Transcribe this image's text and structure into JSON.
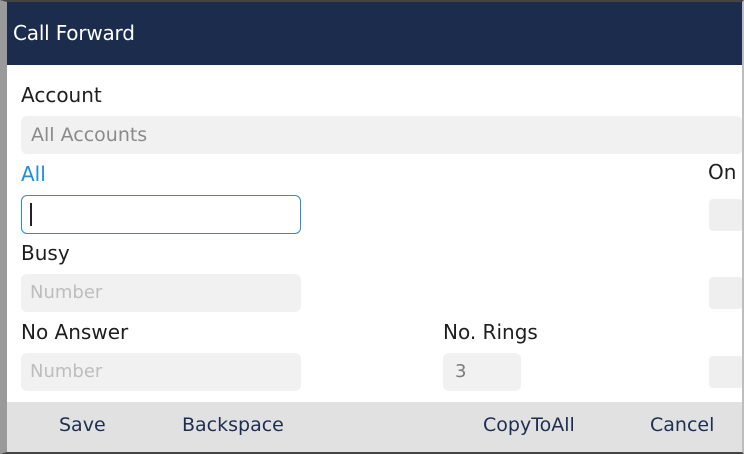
{
  "title": "Call Forward",
  "account": {
    "label": "Account",
    "value": "All Accounts"
  },
  "all": {
    "label": "All",
    "on_label": "On",
    "number_value": ""
  },
  "busy": {
    "label": "Busy",
    "placeholder": "Number"
  },
  "no_answer": {
    "label": "No Answer",
    "placeholder": "Number",
    "rings_label": "No. Rings",
    "rings_value": "3"
  },
  "softkeys": {
    "save": "Save",
    "backspace": "Backspace",
    "copy_to_all": "CopyToAll",
    "cancel": "Cancel"
  },
  "colors": {
    "title_bar": "#1c2c4c",
    "active_label": "#1e90d2",
    "focus_border": "#2a8fc8"
  }
}
